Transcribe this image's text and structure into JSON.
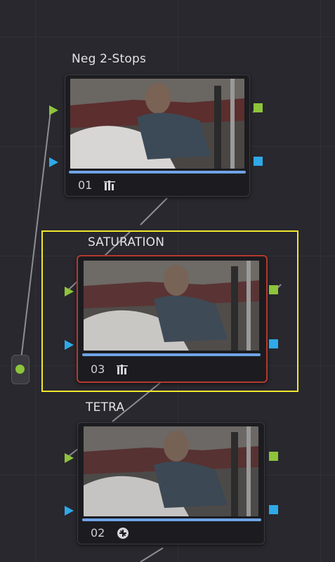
{
  "nodes": [
    {
      "label": "Neg 2-Stops",
      "number": "01",
      "icon": "scopes-bars-icon"
    },
    {
      "label": "SATURATION",
      "number": "03",
      "icon": "scopes-bars-icon",
      "selected": true
    },
    {
      "label": "TETRA",
      "number": "02",
      "icon": "color-wheel-badge-icon"
    }
  ],
  "colors": {
    "background": "#28282e",
    "rgb_port": "#8ec43a",
    "alpha_port": "#2fa9e8",
    "selected_border": "#b23a2e",
    "highlight": "#f0e62e",
    "node_bar": "#6fa3e6"
  }
}
